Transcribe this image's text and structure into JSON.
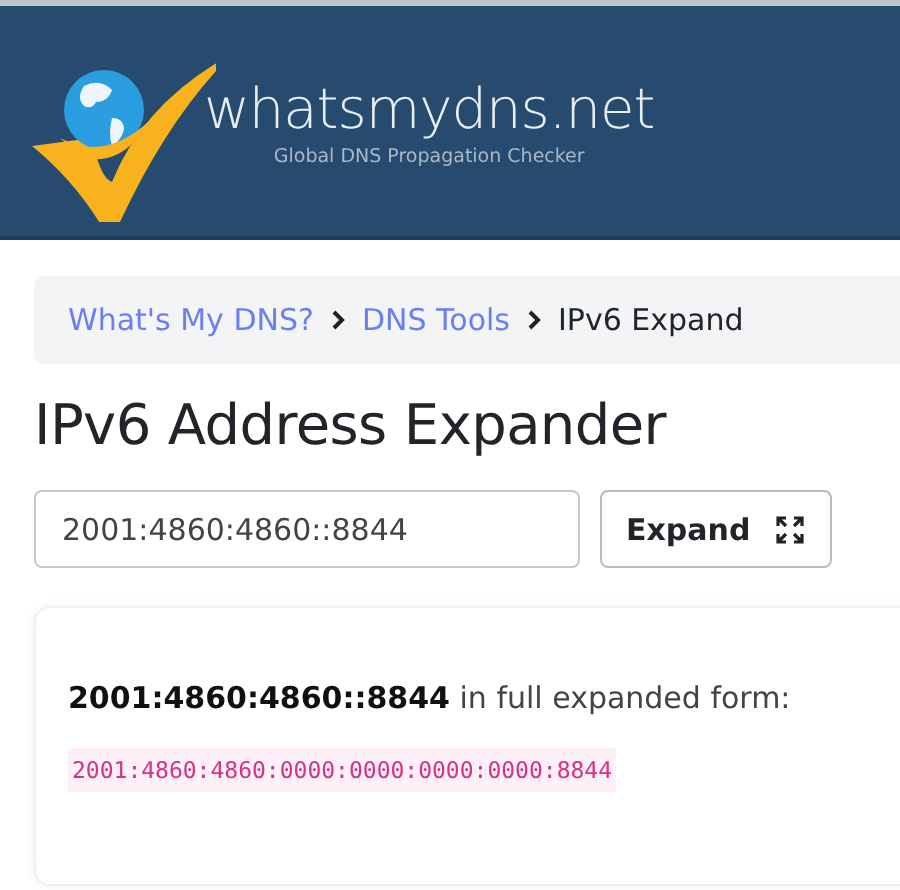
{
  "header": {
    "brand": "whatsmydns.net",
    "tagline": "Global DNS Propagation Checker"
  },
  "breadcrumb": [
    {
      "label": "What's My DNS?",
      "kind": "link"
    },
    {
      "label": "DNS Tools",
      "kind": "link"
    },
    {
      "label": "IPv6 Expand",
      "kind": "current"
    }
  ],
  "title": "IPv6 Address Expander",
  "form": {
    "value": "2001:4860:4860::8844",
    "button": "Expand"
  },
  "result": {
    "sentence": "**2001:4860:4860::8844** in full expanded form:",
    "expanded": "2001:4860:4860:0000:0000:0000:0000:8844"
  }
}
